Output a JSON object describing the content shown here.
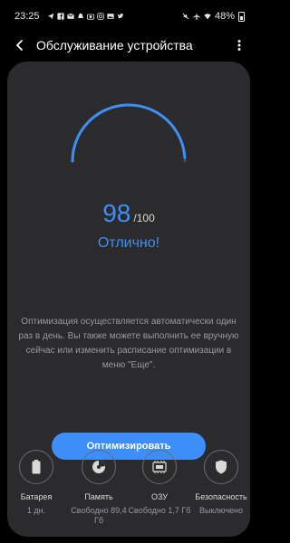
{
  "status_bar": {
    "time": "23:25",
    "battery": "48%",
    "notification_icons": [
      "telegram-icon",
      "facebook-icon",
      "mail-icon",
      "snapchat-icon",
      "camera-icon",
      "instagram-icon",
      "image-icon",
      "twitter-icon"
    ],
    "system_icons": [
      "mute-icon",
      "airplane-icon",
      "wifi-icon",
      "battery-icon"
    ]
  },
  "header": {
    "title": "Обслуживание устройства"
  },
  "score": {
    "value": "98",
    "max": "/100",
    "status": "Отлично!",
    "fraction": 0.98
  },
  "description": "Оптимизация осуществляется автоматически один раз в день. Вы также можете выполнить ее вручную сейчас или изменить расписание оптимизации в меню \"Еще\".",
  "optimize_button": {
    "label": "Оптимизировать"
  },
  "tools": [
    {
      "label": "Батарея",
      "value": "1 дн.",
      "icon": "battery-icon"
    },
    {
      "label": "Память",
      "value": "Свободно 89,4 Гб",
      "icon": "storage-icon"
    },
    {
      "label": "ОЗУ",
      "value": "Свободно 1,7 Гб",
      "icon": "memory-icon"
    },
    {
      "label": "Безопасность",
      "value": "Выключено",
      "icon": "shield-icon"
    }
  ],
  "colors": {
    "accent": "#3e8ef7",
    "card": "#2b2b2d",
    "background": "#000000"
  }
}
